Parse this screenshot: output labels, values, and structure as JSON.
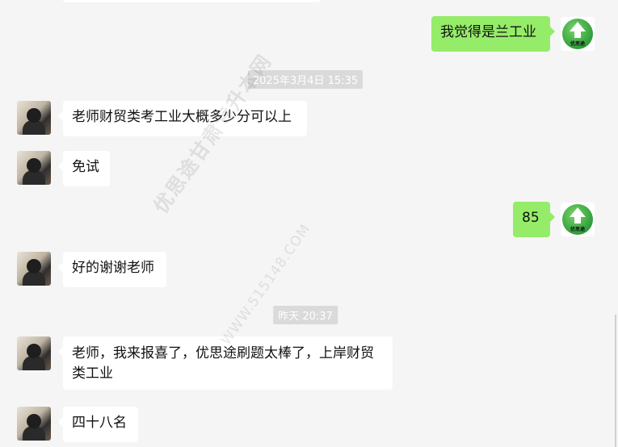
{
  "messages": [
    {
      "side": "out",
      "text": "我觉得是兰工业"
    },
    {
      "side": "in",
      "text": "老师财贸类考工业大概多少分可以上"
    },
    {
      "side": "in",
      "text": "免试"
    },
    {
      "side": "out",
      "text": "85"
    },
    {
      "side": "in",
      "text": "好的谢谢老师"
    },
    {
      "side": "in",
      "text": "老师，我来报喜了，优思途刷题太棒了，上岸财贸类工业"
    },
    {
      "side": "in",
      "text": "四十八名"
    }
  ],
  "timestamps": [
    "2025年3月4日 15:35",
    "昨天 20:37"
  ],
  "avatar_text": "优思途",
  "watermark": {
    "cn": "优思途甘肃专升本网",
    "url": "WWW.515148.COM"
  },
  "colors": {
    "out_bubble": "#95ec69",
    "in_bubble": "#ffffff",
    "background": "#f5f5f5",
    "timestamp_bg": "#dadada"
  },
  "icons": {
    "self_avatar": "green-up-arrow-logo-icon",
    "contact_avatar": "user-photo-avatar"
  }
}
